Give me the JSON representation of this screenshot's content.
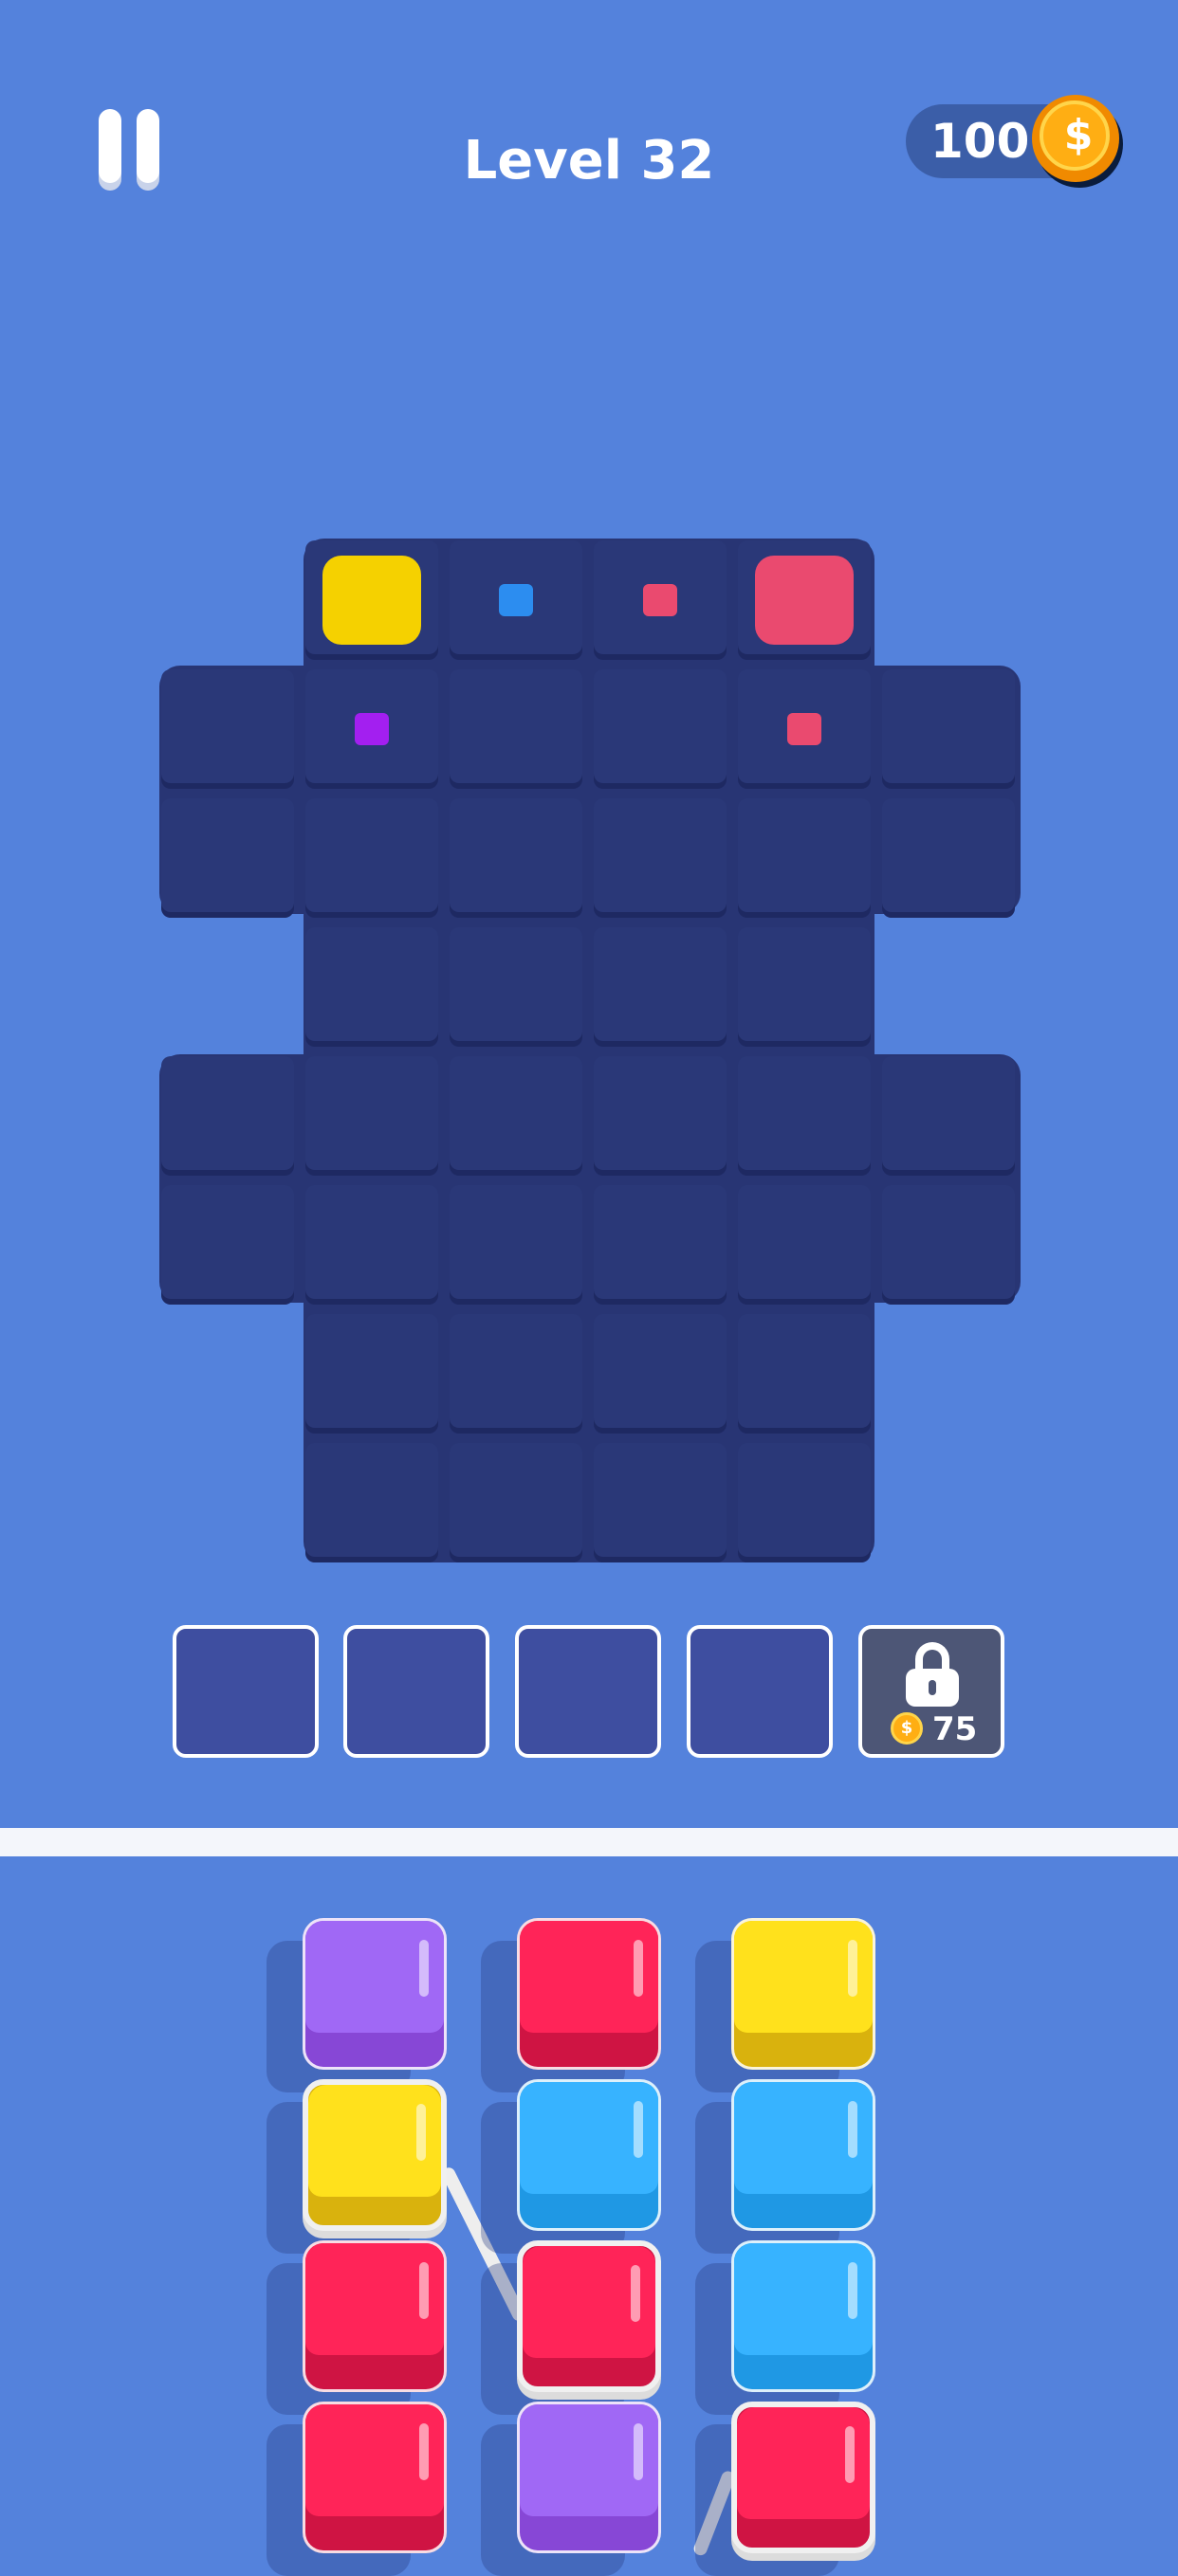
{
  "header": {
    "level_title": "Level 32",
    "coins": "100",
    "coin_symbol": "$"
  },
  "board": {
    "colors": {
      "yellow": "#f5d100",
      "pink": "#ea4a6f",
      "blue": "#2c8df0",
      "purple": "#a31ff0",
      "board": "#283574"
    },
    "pieces": [
      {
        "name": "yellow-piece",
        "color": "yellow",
        "size": "large"
      },
      {
        "name": "blue-piece",
        "color": "blue",
        "size": "small"
      },
      {
        "name": "pink-piece-small",
        "color": "pink",
        "size": "small"
      },
      {
        "name": "pink-piece-large",
        "color": "pink",
        "size": "large"
      },
      {
        "name": "purple-piece",
        "color": "purple",
        "size": "small"
      },
      {
        "name": "pink-piece-small-2",
        "color": "pink",
        "size": "small"
      }
    ]
  },
  "slots": {
    "count_open": 4,
    "locked_price": "75",
    "lock_icon": "padlock-icon"
  },
  "tray": {
    "columns": [
      [
        "purple",
        "yellow",
        "red",
        "red"
      ],
      [
        "red",
        "blue",
        "red",
        "purple"
      ],
      [
        "yellow",
        "blue",
        "blue",
        "red"
      ]
    ],
    "selected": [
      "col1-yellow",
      "col2-red",
      "col3-red"
    ]
  }
}
